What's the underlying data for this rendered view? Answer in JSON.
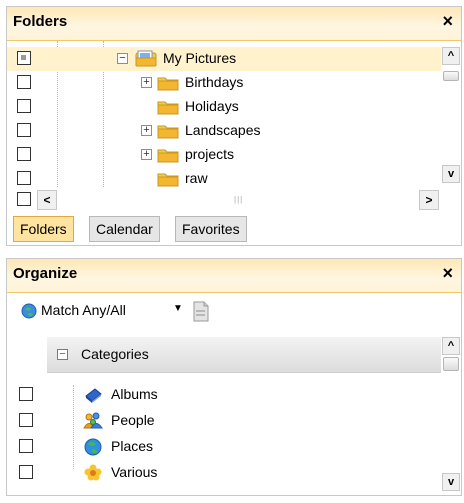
{
  "folders_panel": {
    "title": "Folders",
    "close": "×",
    "tree": [
      {
        "label": "My Pictures",
        "expander": "−",
        "selected": true,
        "check": "partial"
      },
      {
        "label": "Birthdays",
        "expander": "+",
        "check": "none"
      },
      {
        "label": "Holidays",
        "expander": "",
        "check": "none"
      },
      {
        "label": "Landscapes",
        "expander": "+",
        "check": "none"
      },
      {
        "label": "projects",
        "expander": "+",
        "check": "none"
      },
      {
        "label": "raw",
        "expander": "",
        "check": "none"
      }
    ],
    "scroll_left": "<",
    "scroll_right": ">",
    "scroll_up": "^",
    "scroll_down": "v",
    "tabs": [
      {
        "label": "Folders",
        "active": true
      },
      {
        "label": "Calendar",
        "active": false
      },
      {
        "label": "Favorites",
        "active": false
      }
    ]
  },
  "organize_panel": {
    "title": "Organize",
    "close": "×",
    "match_label": "Match Any/All",
    "match_caret": "▼",
    "categories_header": "Categories",
    "categories_toggle": "−",
    "scroll_up": "^",
    "scroll_down": "v",
    "categories": [
      {
        "label": "Albums",
        "icon": "albums-icon"
      },
      {
        "label": "People",
        "icon": "people-icon"
      },
      {
        "label": "Places",
        "icon": "places-globe-icon"
      },
      {
        "label": "Various",
        "icon": "various-flower-icon"
      }
    ]
  },
  "colors": {
    "header_gradient_top": "#ffe7b6",
    "header_border": "#f0c86a",
    "active_tab": "#ffe3a1",
    "folder_yellow": "#f7c948",
    "selected_row": "#fff2cc"
  }
}
